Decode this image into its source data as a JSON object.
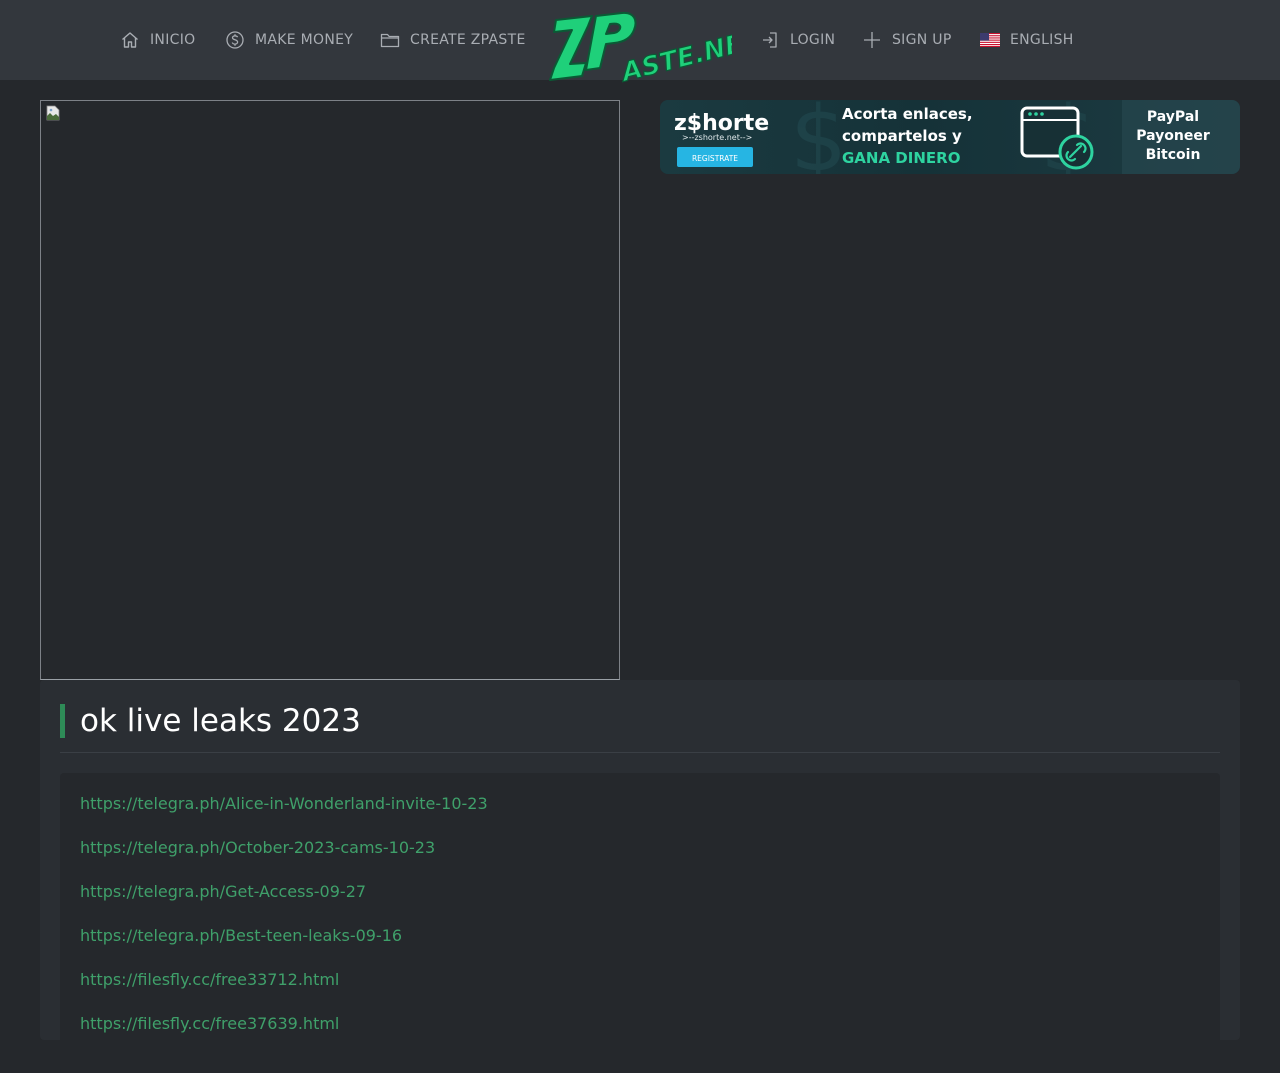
{
  "header": {
    "nav_left": [
      {
        "label": "INICIO",
        "icon": "home-icon"
      },
      {
        "label": "MAKE MONEY",
        "icon": "dollar-icon"
      },
      {
        "label": "CREATE ZPASTE",
        "icon": "folder-icon"
      }
    ],
    "logo_text": "ZPASTE.NET",
    "nav_right": [
      {
        "label": "LOGIN",
        "icon": "login-icon"
      },
      {
        "label": "SIGN UP",
        "icon": "plus-icon"
      },
      {
        "label": "ENGLISH",
        "icon": "us-flag-icon"
      }
    ]
  },
  "banner": {
    "brand": "z$horte",
    "brand_url": ">--zshorte.net-->",
    "cta": "REGISTRATE",
    "line1": "Acorta enlaces,",
    "line2": "compartelos y",
    "line3": "GANA DINERO",
    "pay1": "PayPal",
    "pay2": "Payoneer",
    "pay3": "Bitcoin"
  },
  "paste": {
    "title": "ok live leaks 2023",
    "links": [
      "https://telegra.ph/Alice-in-Wonderland-invite-10-23",
      "https://telegra.ph/October-2023-cams-10-23",
      "https://telegra.ph/Get-Access-09-27",
      "https://telegra.ph/Best-teen-leaks-09-16",
      "https://filesfly.cc/free33712.html",
      "https://filesfly.cc/free37639.html"
    ]
  },
  "colors": {
    "header_bg": "#33373d",
    "page_bg": "#25282c",
    "link": "#3fa06a",
    "accent": "#2e8b57",
    "logo_green": "#1fd07a"
  }
}
